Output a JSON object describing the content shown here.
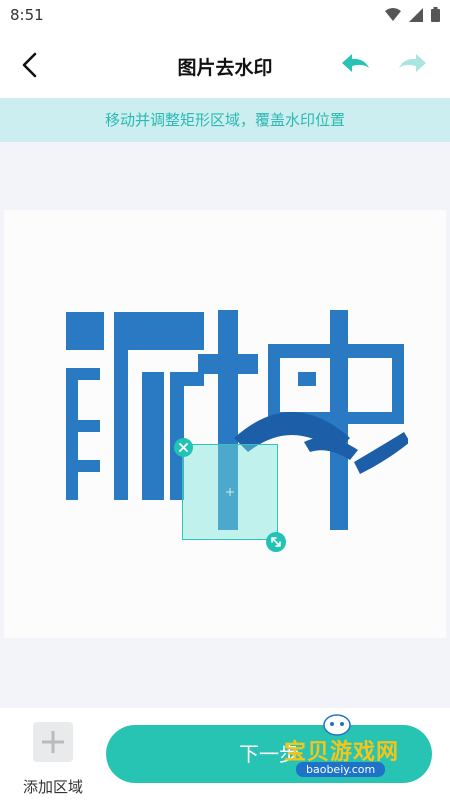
{
  "status_bar": {
    "time": "8:51",
    "icons": [
      "wifi-icon",
      "signal-icon",
      "battery-icon"
    ]
  },
  "app_bar": {
    "title": "图片去水印",
    "back_icon": "chevron-left-icon",
    "undo_icon": "undo-icon",
    "redo_icon": "redo-icon"
  },
  "hint": {
    "text": "移动并调整矩形区域，覆盖水印位置"
  },
  "editor": {
    "image_description_icon": "logo-image",
    "selection_close_icon": "close-icon",
    "selection_resize_icon": "resize-icon"
  },
  "bottom_bar": {
    "add_area_label": "添加区域",
    "next_label": "下一步"
  },
  "watermark": {
    "text": "宝贝游戏网",
    "url": "baobeiy.com"
  },
  "colors": {
    "accent": "#27c4b3",
    "hint_background": "#cdeef0",
    "hint_text": "#2db8b0",
    "redo_disabled": "#a8e6df",
    "logo_blue": "#2a79c3",
    "logo_dark_blue": "#1c5fa8"
  }
}
